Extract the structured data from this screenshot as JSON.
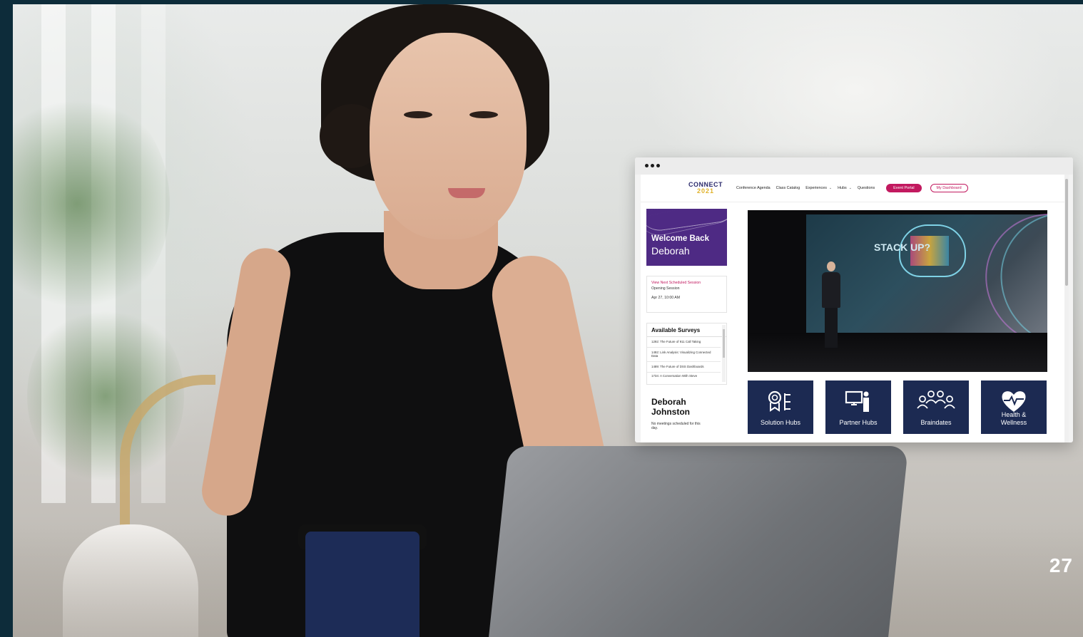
{
  "page_number": "27",
  "browser": {
    "nav": {
      "logo_line1": "CONNECT",
      "logo_line2": "2021",
      "links": [
        "Conference Agenda",
        "Class Catalog",
        "Experiences",
        "Hubs",
        "Questions"
      ],
      "event_portal": "Event Portal",
      "my_dashboard": "My Dashboard"
    },
    "welcome": {
      "line1": "Welcome Back",
      "line2": "Deborah"
    },
    "next_session": {
      "link": "View Next Scheduled Session",
      "title": "Opening Session",
      "time": "Apr 27, 10:00 AM"
    },
    "surveys": {
      "title": "Available Surveys",
      "items": [
        "1292: The Future of 911 Call Taking",
        "1492: Link Analysis: Visualizing Connected Data",
        "1489: The Future of DSS Dashboards",
        "1734: A Conversation With Steve"
      ]
    },
    "user": {
      "first": "Deborah",
      "last": "Johnston",
      "note": "No meetings scheduled for this day."
    },
    "video": {
      "slide_text": "STACK UP?"
    },
    "tiles": [
      {
        "label": "Solution Hubs",
        "icon": "solution-hubs-icon"
      },
      {
        "label": "Partner Hubs",
        "icon": "partner-hubs-icon"
      },
      {
        "label": "Braindates",
        "icon": "braindates-icon"
      },
      {
        "label": "Health & Wellness",
        "icon": "heart-pulse-icon"
      }
    ]
  },
  "colors": {
    "accent": "#c2195f",
    "purple": "#4e2a84",
    "tile_navy": "#1c2a52",
    "page_edge": "#0d2c3a"
  }
}
